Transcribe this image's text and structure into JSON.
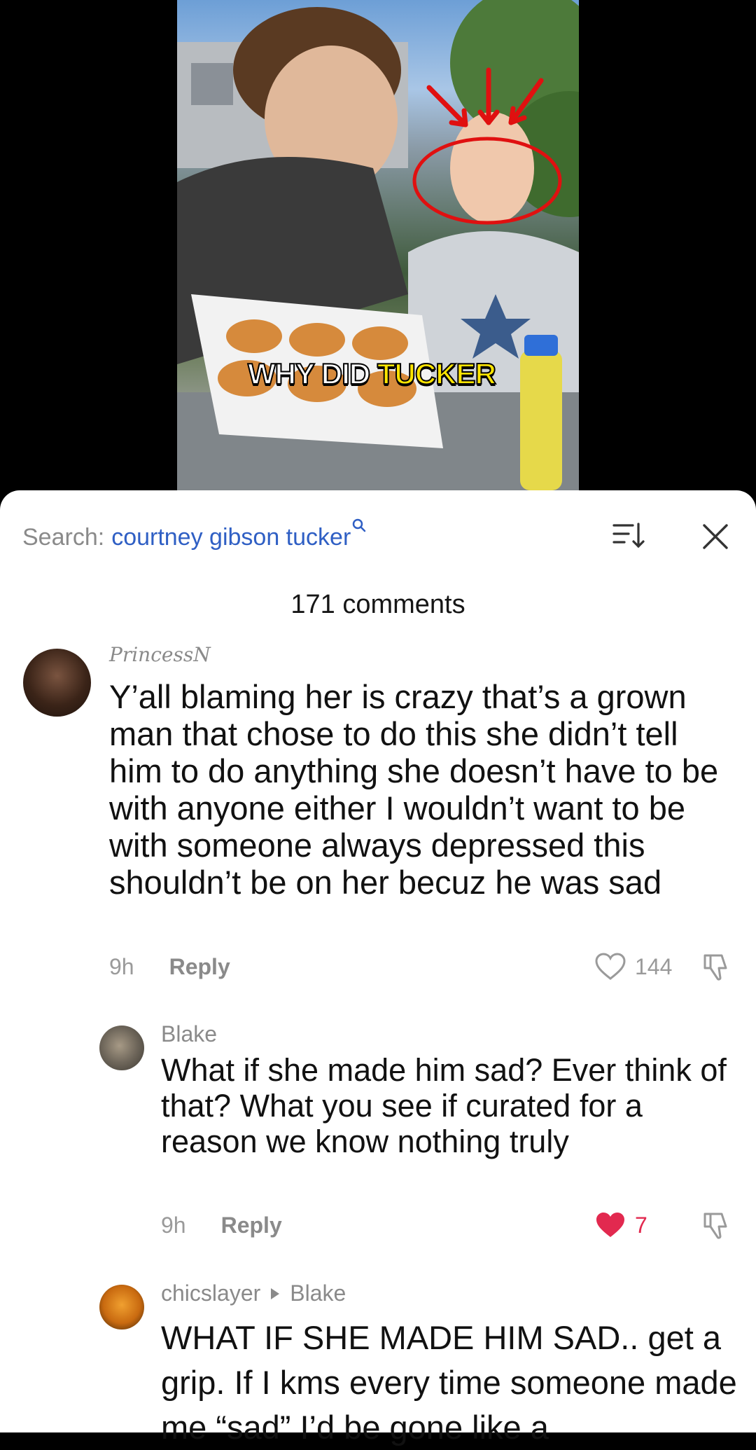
{
  "video": {
    "caption_prefix": "WHY DID",
    "caption_highlight": "TUCKER"
  },
  "search": {
    "label": "Search:",
    "term": "courtney gibson tucker"
  },
  "comments_count": "171 comments",
  "comments": [
    {
      "username": "PrincessN",
      "text": "Y’all blaming her is crazy that’s a grown man that chose to do this she didn’t tell him to do anything she doesn’t have to be with anyone either I wouldn’t want to be with someone always depressed this shouldn’t be on her becuz he was sad",
      "time": "9h",
      "reply_label": "Reply",
      "likes": "144",
      "liked": false
    },
    {
      "username": "Blake",
      "text": "What if she made him sad? Ever think of that? What you see if curated for a reason we know nothing truly",
      "time": "9h",
      "reply_label": "Reply",
      "likes": "7",
      "liked": true
    },
    {
      "username": "chicslayer",
      "reply_to": "Blake",
      "text": "WHAT IF SHE MADE HIM SAD.. get a grip. If I kms every time someone made me “sad” I’d be gone like a"
    }
  ],
  "colors": {
    "link_blue": "#2f5fc4",
    "like_red": "#e2294f",
    "meta_gray": "#9a9a9a"
  },
  "icons": [
    "search-icon",
    "sort-icon",
    "close-icon",
    "heart-icon",
    "heart-filled-icon",
    "dislike-icon",
    "play-right-icon"
  ]
}
